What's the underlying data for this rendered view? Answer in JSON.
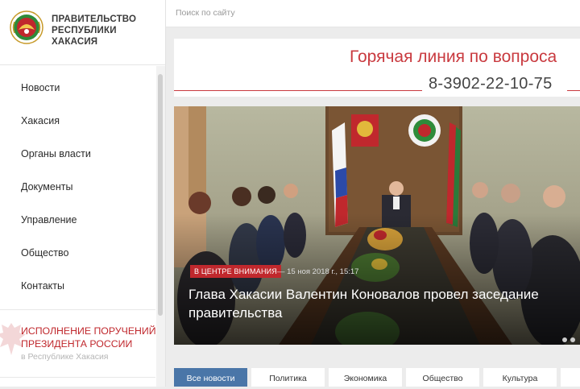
{
  "logo": {
    "line1": "ПРАВИТЕЛЬСТВО",
    "line2": "РЕСПУБЛИКИ",
    "line3": "ХАКАСИЯ"
  },
  "nav": {
    "items": [
      {
        "label": "Новости"
      },
      {
        "label": "Хакасия"
      },
      {
        "label": "Органы власти"
      },
      {
        "label": "Документы"
      },
      {
        "label": "Управление"
      },
      {
        "label": "Общество"
      },
      {
        "label": "Контакты"
      }
    ]
  },
  "special": {
    "title_line1": "ИСПОЛНЕНИЕ ПОРУЧЕНИЙ",
    "title_line2": "ПРЕЗИДЕНТА РОССИИ",
    "subtitle": "в Республике Хакасия"
  },
  "search": {
    "placeholder": "Поиск по сайту"
  },
  "hotline": {
    "title": "Горячая линия по вопроса",
    "phone": "8-3902-22-10-75"
  },
  "hero": {
    "badge": "В ЦЕНТРЕ ВНИМАНИЯ",
    "date": "— 15 ноя 2018 г., 15:17",
    "title": "Глава Хакасии Валентин Коновалов провел заседание правительства"
  },
  "tabs": [
    {
      "label": "Все новости"
    },
    {
      "label": "Политика"
    },
    {
      "label": "Экономика"
    },
    {
      "label": "Общество"
    },
    {
      "label": "Культура"
    },
    {
      "label": ""
    }
  ],
  "colors": {
    "accent_red": "#c93a3f",
    "tab_active": "#4a76a8"
  }
}
